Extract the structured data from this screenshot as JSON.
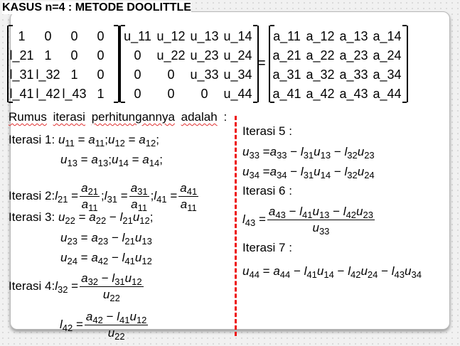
{
  "title": "KASUS n=4 : METODE DOOLITTLE",
  "matrices": {
    "L": [
      "1",
      "0",
      "0",
      "0",
      "l_21",
      "1",
      "0",
      "0",
      "l_31",
      "l_32",
      "1",
      "0",
      "l_41",
      "l_42",
      "l_43",
      "1"
    ],
    "U": [
      "u_11",
      "u_12",
      "u_13",
      "u_14",
      "0",
      "u_22",
      "u_23",
      "u_24",
      "0",
      "0",
      "u_33",
      "u_34",
      "0",
      "0",
      "0",
      "u_44"
    ],
    "equals": "=",
    "A": [
      "a_11",
      "a_12",
      "a_13",
      "a_14",
      "a_21",
      "a_22",
      "a_23",
      "a_24",
      "a_31",
      "a_32",
      "a_33",
      "a_34",
      "a_41",
      "a_42",
      "a_43",
      "a_44"
    ]
  },
  "intro": [
    "Rumus",
    "iterasi",
    "perhitungannya",
    "adalah",
    ":"
  ],
  "left": {
    "it1_label": "Iterasi 1:",
    "it1_line1": "u_11 = a_11;u_12 = a_12;",
    "it1_line2": "u_13 = a_13;u_14 = a_14;",
    "it2_label": "Iterasi 2:",
    "it2_l21": "l_21 =",
    "it2_f1_num": "a_21",
    "it2_f1_den": "a_11",
    "it2_l31": ";l_31 =",
    "it2_f2_num": "a_31",
    "it2_f2_den": "a_11",
    "it2_l41": ";l_41 =",
    "it2_f3_num": "a_41",
    "it2_f3_den": "a_11",
    "it3_label": "Iterasi 3:",
    "it3_line1": "u_22 = a_22 − l_21u_12;",
    "it3_line2": "u_23 = a_23 − l_21u_13",
    "it3_line3": "u_24 = a_42 − l_41u_12",
    "it4_label": "Iterasi 4:",
    "it4_l32": "l_32 =",
    "it4_f1_num": "a_32 − l_31u_12",
    "it4_f1_den": "u_22",
    "it4_l42": "l_42 =",
    "it4_f2_num": "a_42 − l_41u_12",
    "it4_f2_den": "u_22"
  },
  "right": {
    "it5_label": "Iterasi 5 :",
    "it5_line1": "u_33 =a_33−l_31u_13 − l_32u_23",
    "it5_line2": "u_34 =a_34−l_31u_14 − l_32u_24",
    "it6_label": "Iterasi 6 :",
    "it6_l43": "l_43 =",
    "it6_num": "a_43 − l_41u_13 − l_42u_23",
    "it6_den": "u_33",
    "it7_label": "Iterasi 7 :",
    "it7_line": "u_44 = a_44 − l_41u_14 − l_42u_24 − l_43u_34"
  },
  "colors": {
    "divider": "#ee1111",
    "spellcheck": "#e03030"
  }
}
